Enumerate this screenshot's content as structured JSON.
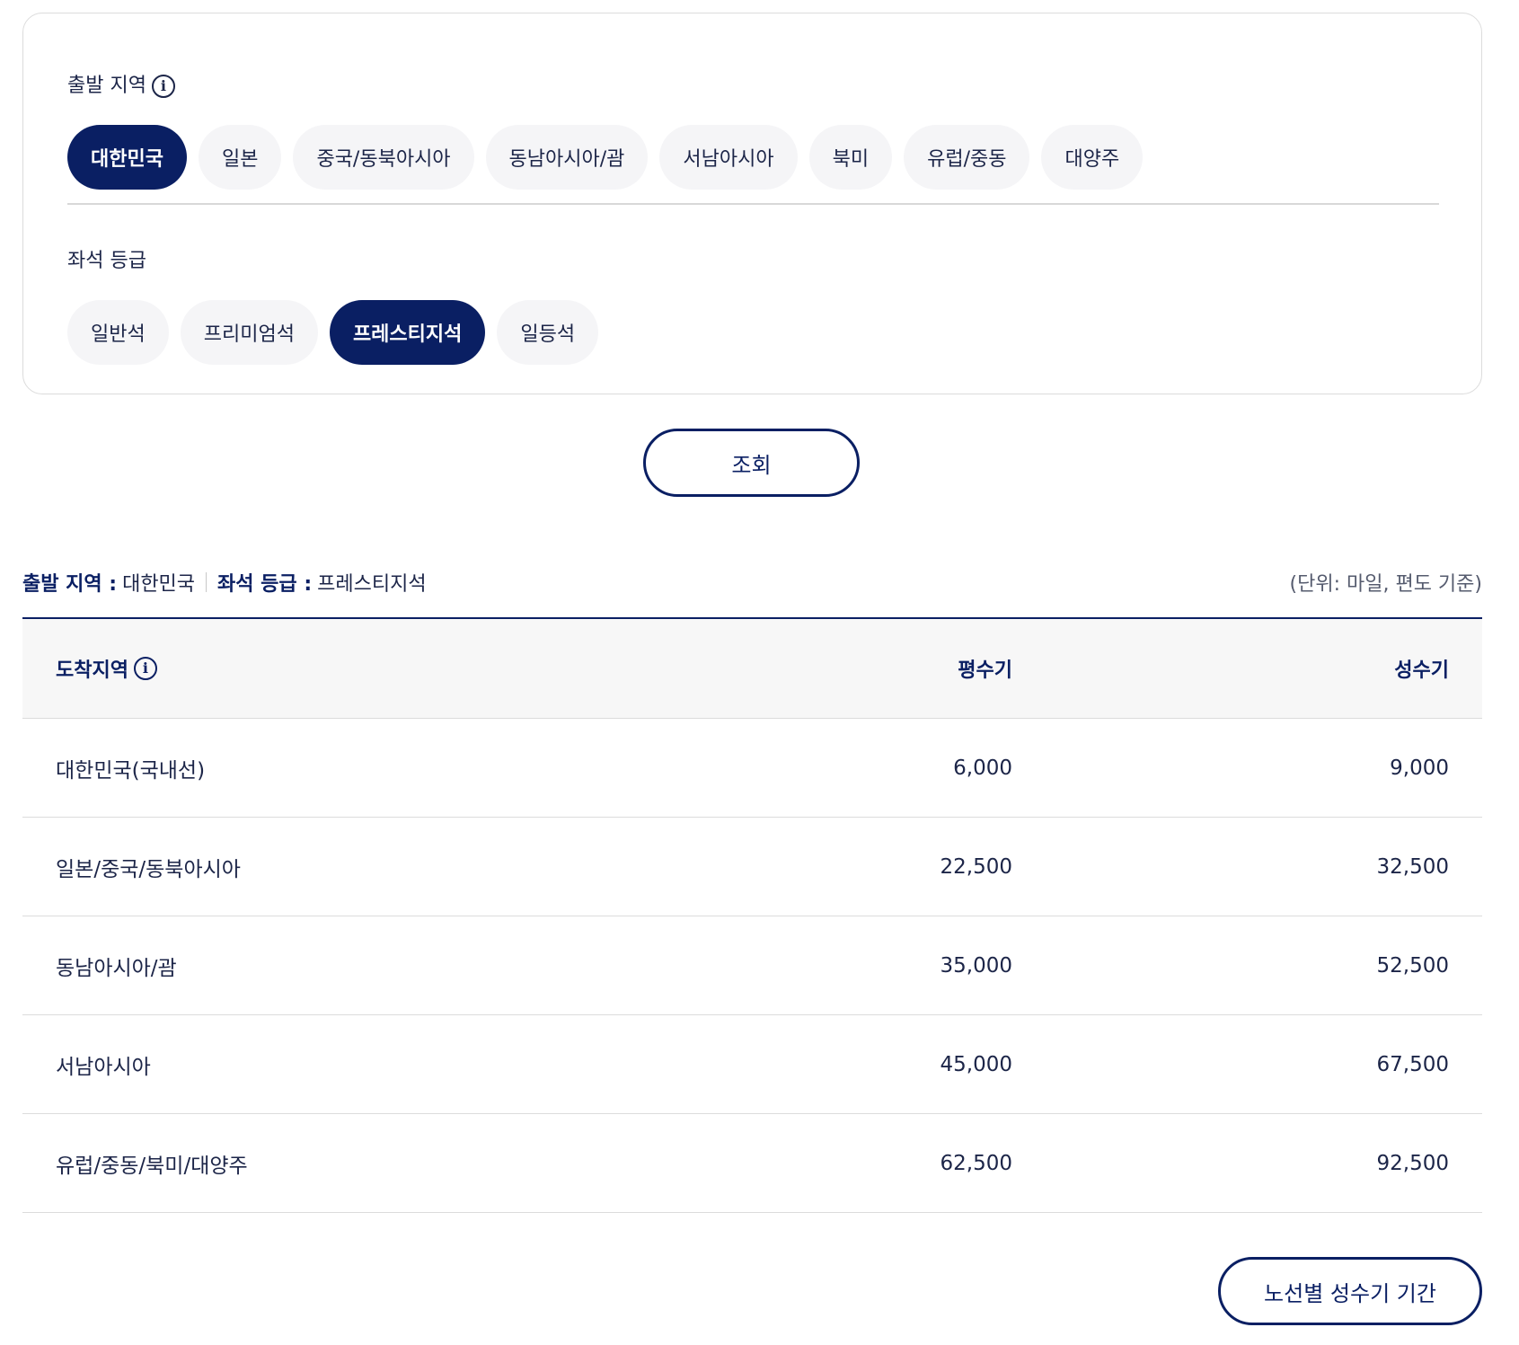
{
  "filters": {
    "departure_label": "출발 지역",
    "departure_options": [
      "대한민국",
      "일본",
      "중국/동북아시아",
      "동남아시아/괌",
      "서남아시아",
      "북미",
      "유럽/중동",
      "대양주"
    ],
    "departure_selected_index": 0,
    "class_label": "좌석 등급",
    "class_options": [
      "일반석",
      "프리미엄석",
      "프레스티지석",
      "일등석"
    ],
    "class_selected_index": 2
  },
  "search_button": "조회",
  "summary": {
    "departure_key": "출발 지역 :",
    "departure_value": "대한민국",
    "class_key": "좌석 등급 :",
    "class_value": "프레스티지석",
    "unit_note": "(단위: 마일, 편도 기준)"
  },
  "table": {
    "headers": {
      "destination": "도착지역",
      "off_peak": "평수기",
      "peak": "성수기"
    },
    "rows": [
      {
        "destination": "대한민국(국내선)",
        "off_peak": "6,000",
        "peak": "9,000"
      },
      {
        "destination": "일본/중국/동북아시아",
        "off_peak": "22,500",
        "peak": "32,500"
      },
      {
        "destination": "동남아시아/괌",
        "off_peak": "35,000",
        "peak": "52,500"
      },
      {
        "destination": "서남아시아",
        "off_peak": "45,000",
        "peak": "67,500"
      },
      {
        "destination": "유럽/중동/북미/대양주",
        "off_peak": "62,500",
        "peak": "92,500"
      }
    ]
  },
  "peak_period_button": "노선별 성수기 기간",
  "colors": {
    "primary": "#0a1f63",
    "chip_bg": "#f5f5f7",
    "header_bg": "#f7f7f7",
    "border": "#dcdcdc"
  },
  "icons": {
    "info": "info-icon"
  }
}
